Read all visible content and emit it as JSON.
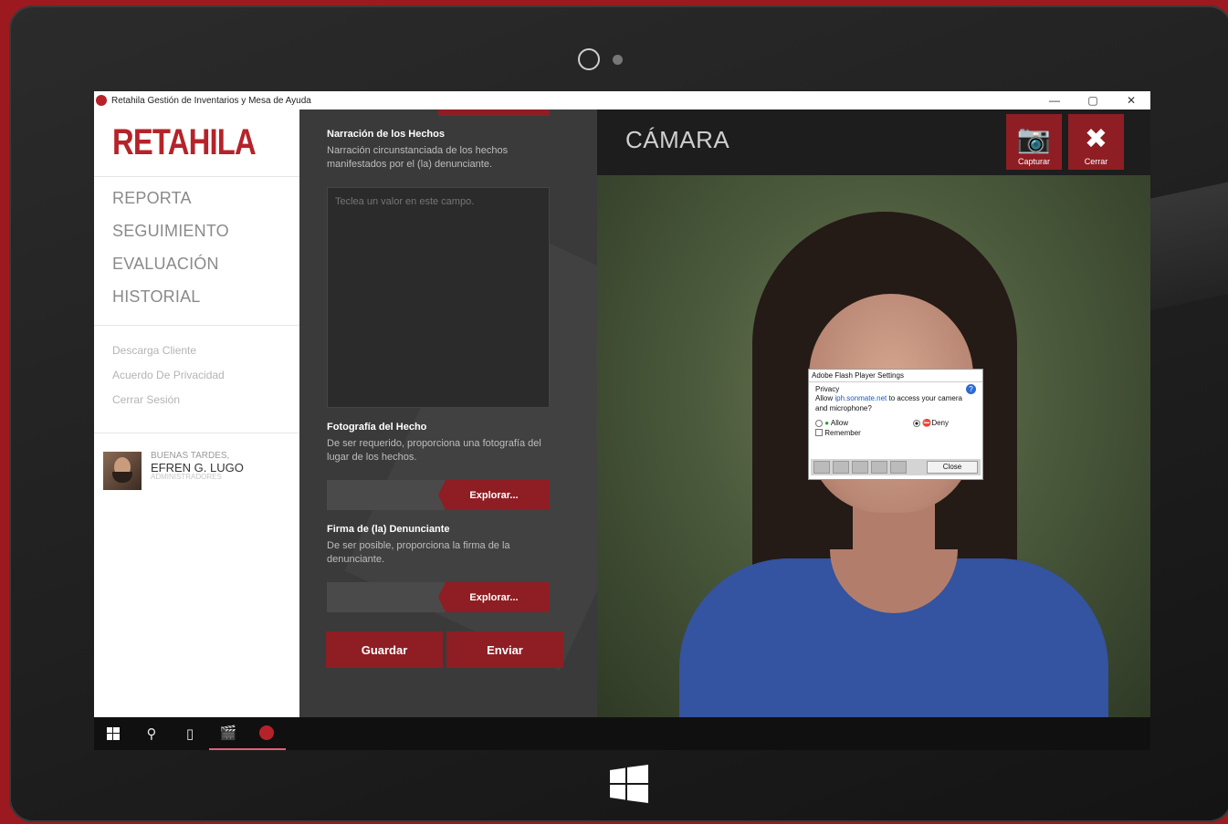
{
  "window": {
    "title": "Retahila Gestión de Inventarios y Mesa de Ayuda",
    "controls": [
      "—",
      "▢",
      "✕"
    ]
  },
  "sidebar": {
    "brand": "RETAHILA",
    "nav": [
      "REPORTA",
      "SEGUIMIENTO",
      "EVALUACIÓN",
      "HISTORIAL"
    ],
    "links": [
      "Descarga Cliente",
      "Acuerdo De Privacidad",
      "Cerrar Sesión"
    ],
    "user": {
      "greeting": "BUENAS TARDES,",
      "name": "EFREN G. LUGO",
      "role": "ADMINISTRADORES"
    }
  },
  "form": {
    "narracion": {
      "title": "Narración de los Hechos",
      "desc": "Narración circunstanciada de los hechos manifestados por el (la) denunciante.",
      "placeholder": "Teclea un valor en este campo."
    },
    "fotografia": {
      "title": "Fotografía del Hecho",
      "desc": "De ser requerido, proporciona una fotografía del lugar de los hechos.",
      "button": "Explorar..."
    },
    "firma": {
      "title": "Firma de (la) Denunciante",
      "desc": "De ser posible, proporciona la firma de la denunciante.",
      "button": "Explorar..."
    },
    "save": "Guardar",
    "send": "Enviar"
  },
  "camera": {
    "title": "CÁMARA",
    "capture": "Capturar",
    "close": "Cerrar"
  },
  "flash": {
    "header": "Adobe Flash Player Settings",
    "section": "Privacy",
    "msg_prefix": "Allow ",
    "domain": "iph.sonmate.net",
    "msg_suffix": " to access your camera and microphone?",
    "allow": "Allow",
    "deny": "Deny",
    "remember": "Remember",
    "close": "Close",
    "selected": "deny"
  },
  "colors": {
    "accent": "#8e1e24",
    "brand": "#b5232a",
    "background": "#9c1a1f"
  }
}
